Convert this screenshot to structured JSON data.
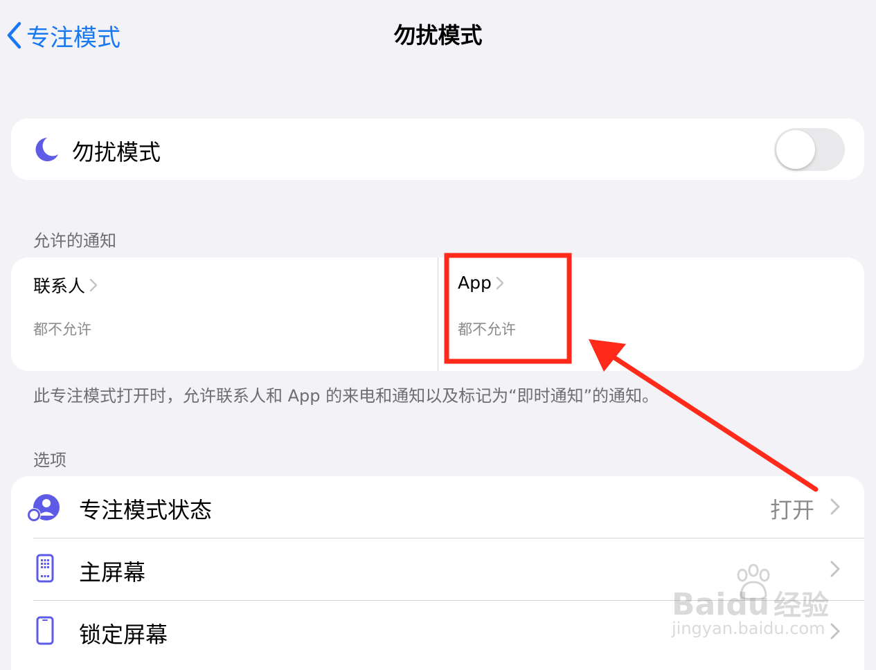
{
  "nav": {
    "back_label": "专注模式",
    "title": "勿扰模式"
  },
  "dnd_row": {
    "label": "勿扰模式",
    "switch_on": false,
    "icon": "moon-icon"
  },
  "allowed": {
    "header": "允许的通知",
    "people": {
      "title": "联系人",
      "subtitle": "都不允许"
    },
    "apps": {
      "title": "App",
      "subtitle": "都不允许"
    },
    "footnote": "此专注模式打开时，允许联系人和 App 的来电和通知以及标记为“即时通知”的通知。"
  },
  "options": {
    "header": "选项",
    "items": [
      {
        "label": "专注模式状态",
        "value": "打开",
        "icon": "focus-status-icon"
      },
      {
        "label": "主屏幕",
        "value": "",
        "icon": "home-screen-icon"
      },
      {
        "label": "锁定屏幕",
        "value": "",
        "icon": "lock-screen-icon"
      }
    ]
  },
  "watermark": {
    "brand": "Bai",
    "brand2": "du",
    "brand_cn": "经验",
    "url": "jingyan.baidu.com"
  },
  "colors": {
    "accent": "#1778f2",
    "icon_purple": "#5e5ce6",
    "annotation_red": "#ff2a1a",
    "background": "#f2f2f7"
  }
}
